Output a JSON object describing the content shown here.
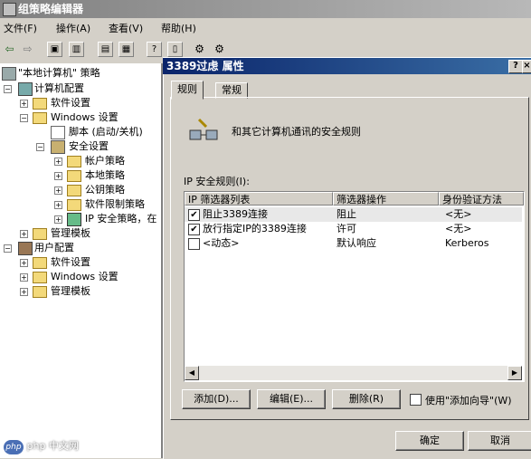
{
  "window": {
    "title": "组策略编辑器"
  },
  "menu": [
    "文件(F)",
    "操作(A)",
    "查看(V)",
    "帮助(H)"
  ],
  "tree": {
    "root": "\"本地计算机\" 策略",
    "items": [
      "计算机配置",
      "软件设置",
      "Windows 设置",
      "脚本 (启动/关机)",
      "安全设置",
      "帐户策略",
      "本地策略",
      "公钥策略",
      "软件限制策略",
      "IP 安全策略，在",
      "管理模板",
      "用户配置",
      "软件设置",
      "Windows 设置",
      "管理模板"
    ]
  },
  "dialog": {
    "title": "3389过虑 属性",
    "help": "?",
    "close": "×",
    "tabs": [
      "规则",
      "常规"
    ],
    "description": "和其它计算机通讯的安全规则",
    "list_label": "IP 安全规则(I):",
    "columns": [
      "IP 筛选器列表",
      "筛选器操作",
      "身份验证方法"
    ],
    "rows": [
      {
        "checked": true,
        "filter": "阻止3389连接",
        "action": "阻止",
        "auth": "<无>"
      },
      {
        "checked": true,
        "filter": "放行指定IP的3389连接",
        "action": "许可",
        "auth": "<无>"
      },
      {
        "checked": false,
        "filter": "<动态>",
        "action": "默认响应",
        "auth": "Kerberos"
      }
    ],
    "buttons": {
      "add": "添加(D)...",
      "edit": "编辑(E)...",
      "remove": "删除(R)"
    },
    "wizard_label": "使用\"添加向导\"(W)",
    "ok": "确定",
    "cancel": "取消"
  },
  "watermark": "php 中文网",
  "colors": {
    "title_active": "#0a246a",
    "title_inactive": "#808080",
    "folder": "#f3d97a"
  }
}
